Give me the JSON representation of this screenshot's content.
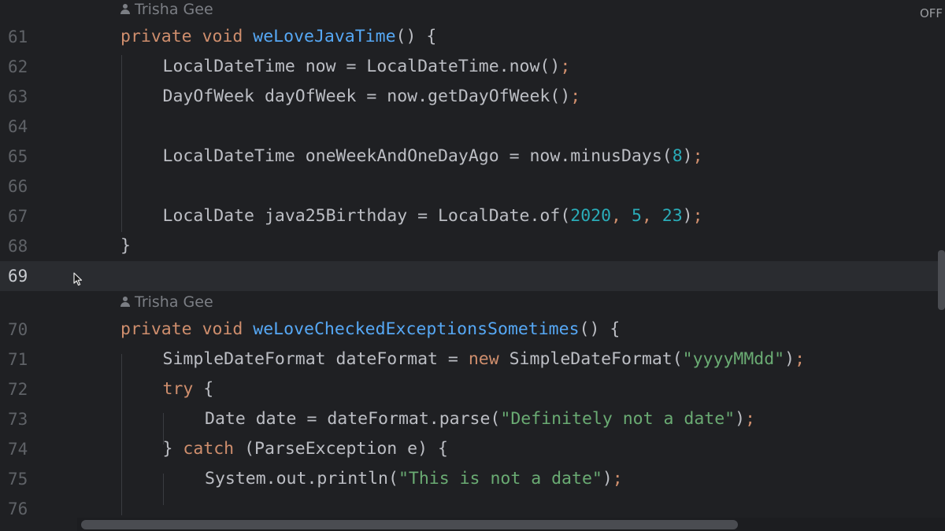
{
  "status": {
    "off_label": "OFF"
  },
  "colors": {
    "background": "#1f2023",
    "current_line": "#2a2c30",
    "keyword": "#cf8e6d",
    "method": "#56a8f5",
    "number": "#2aacb8",
    "string": "#6aab73",
    "default_text": "#bcbec4",
    "line_number": "#5f6267"
  },
  "icons": [
    "person-icon",
    "mouse-cursor-icon"
  ],
  "current_line": "69",
  "lines": [
    {
      "kind": "author",
      "text": "Trisha Gee"
    },
    {
      "kind": "code",
      "num": "61",
      "indent": 1,
      "tokens": [
        {
          "t": "private ",
          "c": "kw"
        },
        {
          "t": "void ",
          "c": "kw"
        },
        {
          "t": "weLoveJavaTime",
          "c": "fn"
        },
        {
          "t": "() {",
          "c": ""
        }
      ]
    },
    {
      "kind": "code",
      "num": "62",
      "indent": 2,
      "tokens": [
        {
          "t": "LocalDateTime now = LocalDateTime.now()",
          "c": ""
        },
        {
          "t": ";",
          "c": "punc"
        }
      ]
    },
    {
      "kind": "code",
      "num": "63",
      "indent": 2,
      "tokens": [
        {
          "t": "DayOfWeek dayOfWeek = now.getDayOfWeek()",
          "c": ""
        },
        {
          "t": ";",
          "c": "punc"
        }
      ]
    },
    {
      "kind": "code",
      "num": "64",
      "indent": 2,
      "tokens": []
    },
    {
      "kind": "code",
      "num": "65",
      "indent": 2,
      "tokens": [
        {
          "t": "LocalDateTime oneWeekAndOneDayAgo = now.minusDays(",
          "c": ""
        },
        {
          "t": "8",
          "c": "num"
        },
        {
          "t": ")",
          "c": ""
        },
        {
          "t": ";",
          "c": "punc"
        }
      ]
    },
    {
      "kind": "code",
      "num": "66",
      "indent": 2,
      "tokens": []
    },
    {
      "kind": "code",
      "num": "67",
      "indent": 2,
      "tokens": [
        {
          "t": "LocalDate java25Birthday = LocalDate.of(",
          "c": ""
        },
        {
          "t": "2020",
          "c": "num"
        },
        {
          "t": ", ",
          "c": "punc"
        },
        {
          "t": "5",
          "c": "num"
        },
        {
          "t": ", ",
          "c": "punc"
        },
        {
          "t": "23",
          "c": "num"
        },
        {
          "t": ")",
          "c": ""
        },
        {
          "t": ";",
          "c": "punc"
        }
      ]
    },
    {
      "kind": "code",
      "num": "68",
      "indent": 1,
      "tokens": [
        {
          "t": "}",
          "c": ""
        }
      ]
    },
    {
      "kind": "code",
      "num": "69",
      "indent": 1,
      "tokens": []
    },
    {
      "kind": "author",
      "text": "Trisha Gee"
    },
    {
      "kind": "code",
      "num": "70",
      "indent": 1,
      "tokens": [
        {
          "t": "private ",
          "c": "kw"
        },
        {
          "t": "void ",
          "c": "kw"
        },
        {
          "t": "weLoveCheckedExceptionsSometimes",
          "c": "fn"
        },
        {
          "t": "() {",
          "c": ""
        }
      ]
    },
    {
      "kind": "code",
      "num": "71",
      "indent": 2,
      "tokens": [
        {
          "t": "SimpleDateFormat dateFormat = ",
          "c": ""
        },
        {
          "t": "new ",
          "c": "kw"
        },
        {
          "t": "SimpleDateFormat(",
          "c": ""
        },
        {
          "t": "\"yyyyMMdd\"",
          "c": "str"
        },
        {
          "t": ")",
          "c": ""
        },
        {
          "t": ";",
          "c": "punc"
        }
      ]
    },
    {
      "kind": "code",
      "num": "72",
      "indent": 2,
      "tokens": [
        {
          "t": "try ",
          "c": "kw"
        },
        {
          "t": "{",
          "c": ""
        }
      ]
    },
    {
      "kind": "code",
      "num": "73",
      "indent": 3,
      "tokens": [
        {
          "t": "Date date = dateFormat.parse(",
          "c": ""
        },
        {
          "t": "\"Definitely not a date\"",
          "c": "str"
        },
        {
          "t": ")",
          "c": ""
        },
        {
          "t": ";",
          "c": "punc"
        }
      ]
    },
    {
      "kind": "code",
      "num": "74",
      "indent": 2,
      "tokens": [
        {
          "t": "} ",
          "c": ""
        },
        {
          "t": "catch ",
          "c": "kw"
        },
        {
          "t": "(ParseException e) {",
          "c": ""
        }
      ]
    },
    {
      "kind": "code",
      "num": "75",
      "indent": 3,
      "tokens": [
        {
          "t": "System.out.println(",
          "c": ""
        },
        {
          "t": "\"This is not a date\"",
          "c": "str"
        },
        {
          "t": ")",
          "c": ""
        },
        {
          "t": ";",
          "c": "punc"
        }
      ]
    },
    {
      "kind": "code",
      "num": "76",
      "indent": 2,
      "tokens": []
    }
  ]
}
